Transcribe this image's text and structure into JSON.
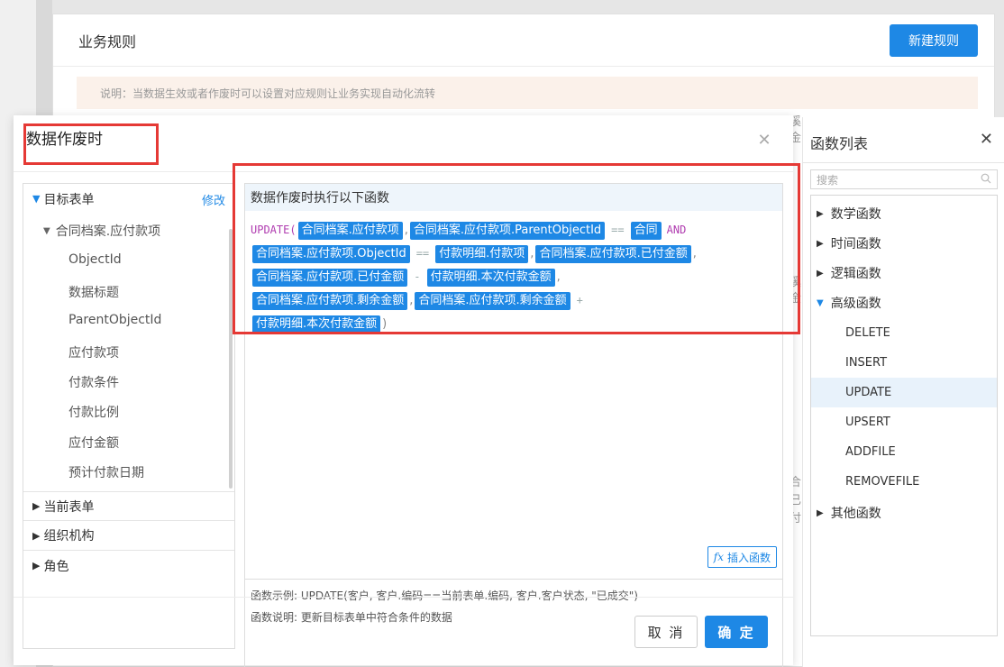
{
  "background": {
    "title": "业务规则",
    "new_rule_button": "新建规则",
    "note": "说明：当数据生效或者作废时可以设置对应规则让业务实现自动化流转",
    "peek_texts": [
      "溪",
      "金",
      "溪",
      "金",
      "合",
      "已",
      "付"
    ]
  },
  "modal": {
    "title": "数据作废时",
    "close_icon": "close-icon",
    "tree": {
      "target_section": "目标表单",
      "edit_label": "修改",
      "sub_form": "合同档案.应付款项",
      "fields": [
        "ObjectId",
        "数据标题",
        "ParentObjectId",
        "应付款项",
        "付款条件",
        "付款比例",
        "应付金额",
        "预计付款日期"
      ],
      "current_section": "当前表单",
      "org_section": "组织机构",
      "role_section": "角色"
    },
    "editor": {
      "header": "数据作废时执行以下函数",
      "code": {
        "fn": "UPDATE(",
        "t1": "合同档案.应付款项",
        "c1": ",",
        "t2": "合同档案.应付款项.ParentObjectId",
        "eq1": "==",
        "t3": "合同",
        "and1": "AND",
        "t4": "合同档案.应付款项.ObjectId",
        "eq2": "==",
        "t5": "付款明细.付款项",
        "c2": ",",
        "t6": "合同档案.应付款项.已付金额",
        "c3": ",",
        "t7": "合同档案.应付款项.已付金额",
        "minus": "-",
        "t8": "付款明细.本次付款金额",
        "c4": ",",
        "t9": "合同档案.应付款项.剩余金额",
        "c5": ",",
        "t10": "合同档案.应付款项.剩余金额",
        "plus": "+",
        "t11": "付款明细.本次付款金额",
        "close": ")"
      },
      "insert_button": "插入函数",
      "insert_icon": "fx-icon"
    },
    "example": {
      "line1": "函数示例: UPDATE(客户, 客户.编码==当前表单.编码, 客户.客户状态, \"已成交\")",
      "line2": "函数说明: 更新目标表单中符合条件的数据"
    },
    "cancel_button": "取 消",
    "ok_button": "确 定"
  },
  "function_panel": {
    "title": "函数列表",
    "search_placeholder": "搜索",
    "categories": [
      "数学函数",
      "时间函数",
      "逻辑函数",
      "高级函数",
      "其他函数"
    ],
    "advanced_items": [
      "DELETE",
      "INSERT",
      "UPDATE",
      "UPSERT",
      "ADDFILE",
      "REMOVEFILE"
    ],
    "selected_item": "UPDATE"
  },
  "colors": {
    "primary": "#1e88e5",
    "highlight_border": "#e53935",
    "keyword": "#b03cb0"
  }
}
